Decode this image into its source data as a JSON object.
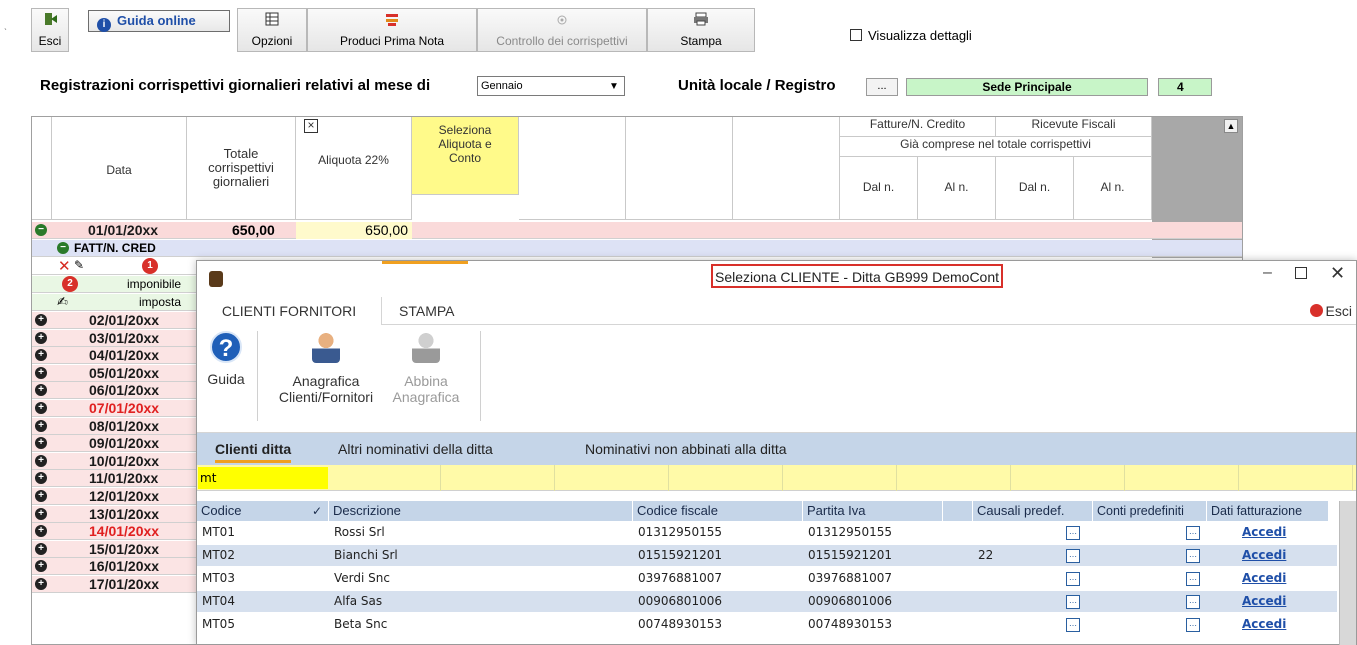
{
  "toolbar": {
    "exit_label": "Esci",
    "guide_label": "Guida online",
    "options_label": "Opzioni",
    "produce_label": "Produci Prima Nota",
    "control_label": "Controllo dei corrispettivi",
    "print_label": "Stampa",
    "details_label": "Visualizza dettagli"
  },
  "header": {
    "title": "Registrazioni corrispettivi giornalieri relativi al mese di",
    "month": "Gennaio",
    "unit_label": "Unità locale / Registro",
    "dots": "...",
    "sede": "Sede Principale",
    "sede_num": "4"
  },
  "grid": {
    "col_data": "Data",
    "col_totale": "Totale corrispettivi giornalieri",
    "col_aliquota": "Aliquota 22%",
    "col_seleziona": "Seleziona Aliquota e Conto",
    "x_mark": "×",
    "fatture": "Fatture/N. Credito",
    "ricevute": "Ricevute Fiscali",
    "gia": "Già comprese nel totale corrispettivi",
    "dal1": "Dal n.",
    "al1": "Al n.",
    "dal2": "Dal n.",
    "al2": "Al n.",
    "first_date": "01/01/20xx",
    "first_total": "650,00",
    "first_aliq": "650,00",
    "fatt": "FATT/N. CRED",
    "badge1": "1",
    "badge2": "2",
    "imponibile": "imponibile",
    "imposta": "imposta",
    "dates": [
      "02/01/20xx",
      "03/01/20xx",
      "04/01/20xx",
      "05/01/20xx",
      "06/01/20xx",
      "07/01/20xx",
      "08/01/20xx",
      "09/01/20xx",
      "10/01/20xx",
      "11/01/20xx",
      "12/01/20xx",
      "13/01/20xx",
      "14/01/20xx",
      "15/01/20xx",
      "16/01/20xx",
      "17/01/20xx"
    ]
  },
  "dialog": {
    "title": "Seleziona CLIENTE  - Ditta GB999 DemoCont",
    "esci": "Esci",
    "tabs": [
      "CLIENTI FORNITORI",
      "STAMPA"
    ],
    "ribbon": {
      "guida": "Guida",
      "anagrafica_1": "Anagrafica",
      "anagrafica_2": "Clienti/Fornitori",
      "abbina_1": "Abbina",
      "abbina_2": "Anagrafica"
    },
    "subtabs": [
      "Clienti ditta",
      "Altri nominativi della ditta",
      "Nominativi non abbinati alla ditta"
    ],
    "search_value": "mt",
    "columns": [
      "Codice",
      "Descrizione",
      "Codice fiscale",
      "Partita Iva",
      "Causali predef.",
      "Conti predefiniti",
      "Dati fatturazione"
    ],
    "rows": [
      {
        "codice": "MT01",
        "descrizione": "Rossi Srl",
        "cf": "01312950155",
        "piva": "01312950155",
        "causale": "",
        "link": "Accedi"
      },
      {
        "codice": "MT02",
        "descrizione": "Bianchi Srl",
        "cf": "01515921201",
        "piva": "01515921201",
        "causale": "22",
        "link": "Accedi"
      },
      {
        "codice": "MT03",
        "descrizione": "Verdi Snc",
        "cf": "03976881007",
        "piva": "03976881007",
        "causale": "",
        "link": "Accedi"
      },
      {
        "codice": "MT04",
        "descrizione": "Alfa Sas",
        "cf": "00906801006",
        "piva": "00906801006",
        "causale": "",
        "link": "Accedi"
      },
      {
        "codice": "MT05",
        "descrizione": "Beta Snc",
        "cf": "00748930153",
        "piva": "00748930153",
        "causale": "",
        "link": "Accedi"
      }
    ]
  }
}
